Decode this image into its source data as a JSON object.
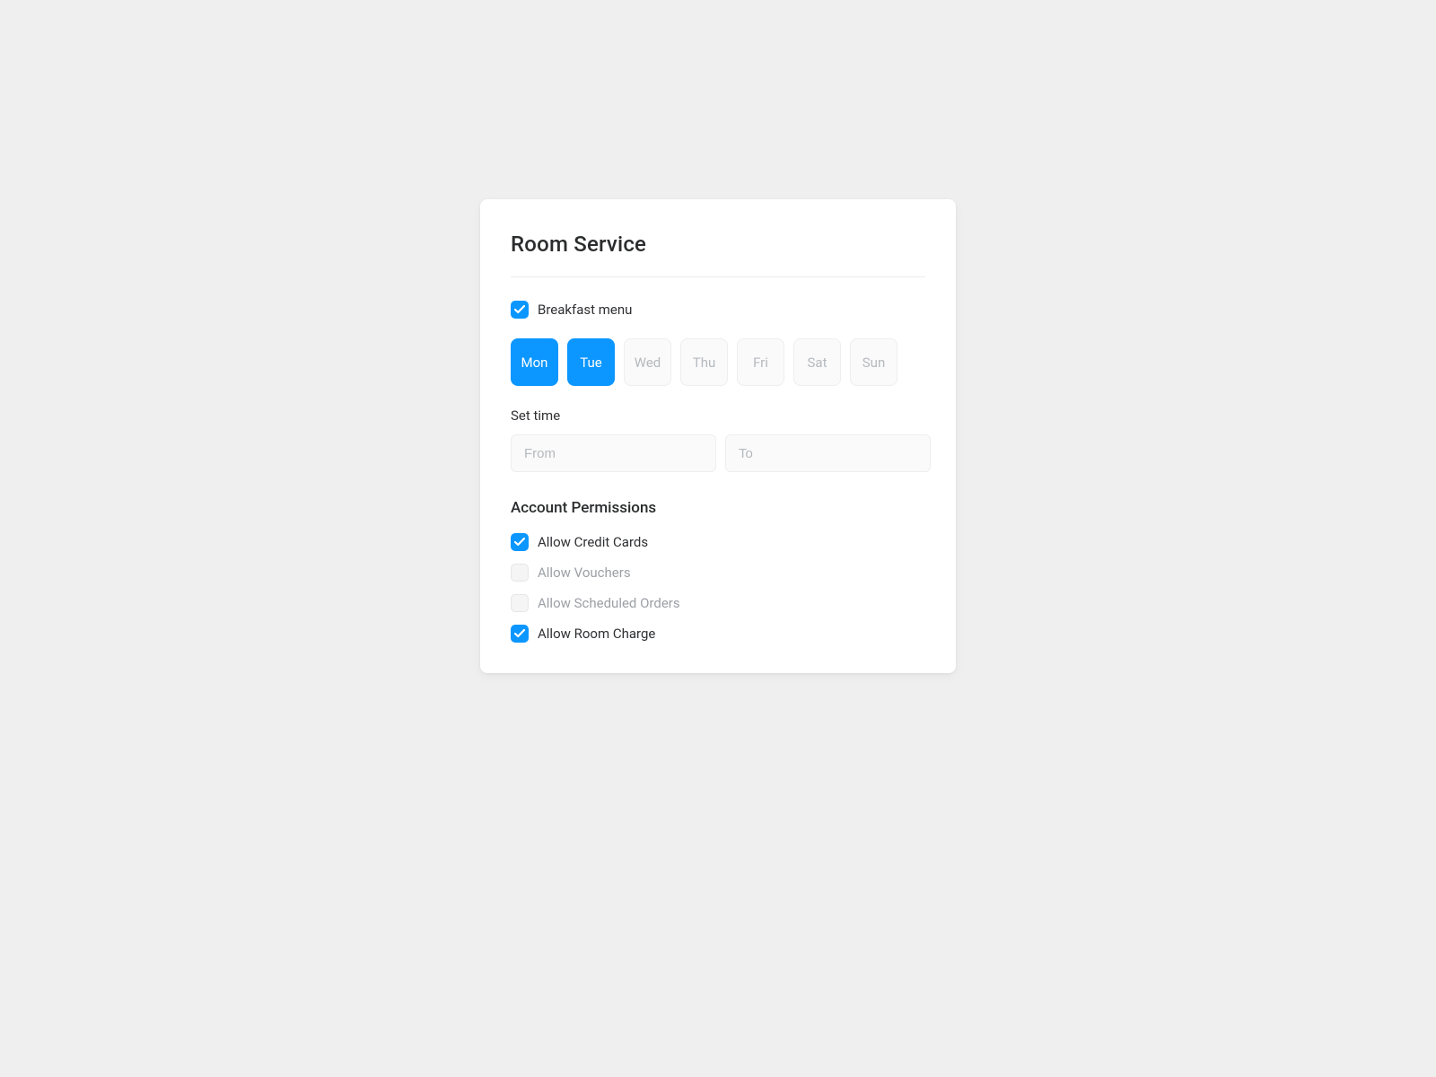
{
  "card": {
    "title": "Room Service"
  },
  "breakfast": {
    "label": "Breakfast menu",
    "checked": true
  },
  "days": [
    {
      "label": "Mon",
      "selected": true
    },
    {
      "label": "Tue",
      "selected": true
    },
    {
      "label": "Wed",
      "selected": false
    },
    {
      "label": "Thu",
      "selected": false
    },
    {
      "label": "Fri",
      "selected": false
    },
    {
      "label": "Sat",
      "selected": false
    },
    {
      "label": "Sun",
      "selected": false
    }
  ],
  "time": {
    "section_label": "Set time",
    "from_placeholder": "From",
    "to_placeholder": "To",
    "from_value": "",
    "to_value": ""
  },
  "permissions": {
    "title": "Account Permissions",
    "items": [
      {
        "label": "Allow Credit Cards",
        "checked": true
      },
      {
        "label": "Allow Vouchers",
        "checked": false
      },
      {
        "label": "Allow Scheduled Orders",
        "checked": false
      },
      {
        "label": "Allow Room Charge",
        "checked": true
      }
    ]
  }
}
